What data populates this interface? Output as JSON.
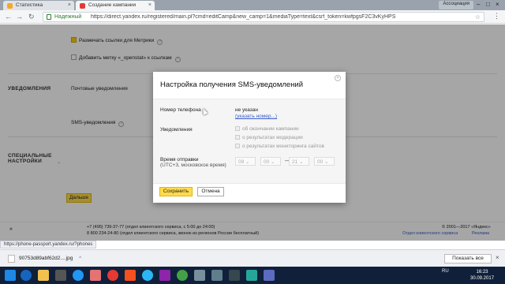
{
  "browser": {
    "tabs": [
      {
        "label": "Статистика",
        "favicon_color": "#f7a823",
        "active": false
      },
      {
        "label": "Создание кампании",
        "favicon_color": "#e53935",
        "active": true
      }
    ],
    "profile_label": "Ассоциация",
    "address": {
      "secure_label": "Надежный",
      "url": "https://direct.yandex.ru/registered/main.pl?cmd=editCamp&new_camp=1&mediaType=text&csrf_token=kwfpgsF2C3vKyHPS"
    }
  },
  "page": {
    "options": [
      {
        "label": "Размечать ссылки для Метрики",
        "checked": true
      },
      {
        "label": "Добавить метку «_openstat» к ссылкам",
        "checked": false
      }
    ],
    "sections": {
      "notifications": "УВЕДОМЛЕНИЯ",
      "special_settings": "СПЕЦИАЛЬНЫЕ НАСТРОЙКИ"
    },
    "notification_rows": {
      "email": "Почтовые уведомления",
      "sms": "SMS-уведомления"
    },
    "next_button": "Дальше",
    "footer": {
      "phones": "+7 (495) 739-37-77 (отдел клиентского сервиса, с 5:00 до 24:00)",
      "phones2": "8 800 234-24-80 (отдел клиентского сервиса, звонок из регионов России бесплатный)",
      "copyright": "© 2001—2017 «Яндекс»",
      "link1": "Отдел клиентского сервиса",
      "link2": "Реклама"
    }
  },
  "modal": {
    "title": "Настройка получения SMS-уведомлений",
    "phone_label": "Номер телефона",
    "phone_value": "не указан",
    "phone_link": "(указать номер...)",
    "notifications_label": "Уведомления",
    "notification_options": [
      "об окончании кампании",
      "о результатах модерации",
      "о результатах мониторинга сайтов"
    ],
    "send_time_label": "Время отправки",
    "send_time_sub": "(UTC+3, московское время)",
    "time_from": {
      "hour": "09",
      "min": "00"
    },
    "time_to": {
      "hour": "21",
      "min": "00"
    },
    "dash": "—",
    "save_button": "Сохранить",
    "cancel_button": "Отмена"
  },
  "status_url": "https://phone-passport.yandex.ru/?phones",
  "downloads": {
    "file_name": "90753d89abf62d2....jpg",
    "show_all": "Показать все"
  },
  "taskbar": {
    "lang": "RU",
    "time": "16:23",
    "date": "30.09.2017"
  }
}
